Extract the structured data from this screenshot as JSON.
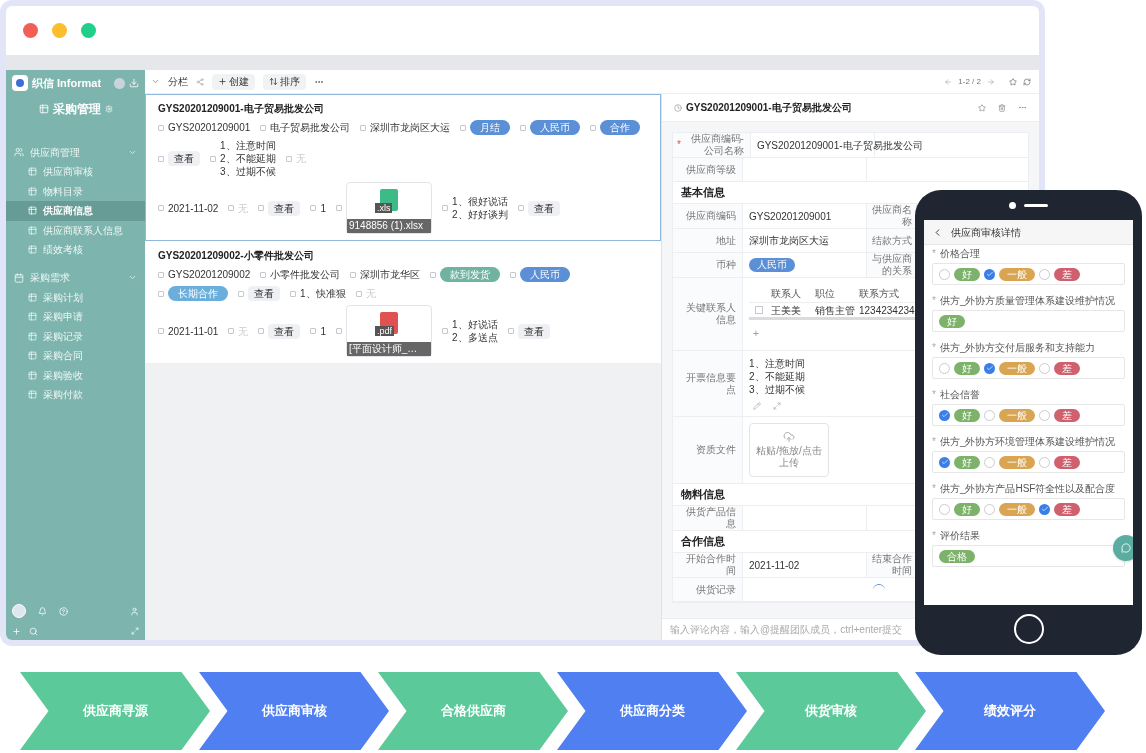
{
  "sidebar": {
    "app_name": "织信 Informat",
    "module": "采购管理",
    "groups": [
      {
        "label": "供应商管理",
        "expanded": true,
        "children": [
          {
            "label": "供应商审核",
            "selected": false
          },
          {
            "label": "物料目录",
            "selected": false
          },
          {
            "label": "供应商信息",
            "selected": true
          },
          {
            "label": "供应商联系人信息",
            "selected": false
          },
          {
            "label": "绩效考核",
            "selected": false
          }
        ]
      },
      {
        "label": "采购需求",
        "expanded": true,
        "children": [
          {
            "label": "采购计划",
            "selected": false
          },
          {
            "label": "采购申请",
            "selected": false
          },
          {
            "label": "采购记录",
            "selected": false
          },
          {
            "label": "采购合同",
            "selected": false
          },
          {
            "label": "采购验收",
            "selected": false
          },
          {
            "label": "采购付款",
            "selected": false
          }
        ]
      }
    ]
  },
  "toolbar": {
    "view": "分栏",
    "buttons": [
      "创建",
      "排序"
    ],
    "pagination": "1-2 / 2"
  },
  "records": [
    {
      "title": "GYS20201209001-电子贸易批发公司",
      "selected": true,
      "row1": [
        {
          "kind": "text",
          "text": "GYS20201209001"
        },
        {
          "kind": "text",
          "text": "电子贸易批发公司"
        },
        {
          "kind": "text",
          "text": "深圳市龙岗区大运"
        },
        {
          "kind": "tag",
          "text": "月结",
          "color": "#5b8fd6"
        },
        {
          "kind": "tag",
          "text": "人民币",
          "color": "#5b8fd6"
        },
        {
          "kind": "tag",
          "text": "合作",
          "color": "#5b8fd6"
        },
        {
          "kind": "button",
          "text": "查看"
        },
        {
          "kind": "lines",
          "lines": [
            "1、注意时间",
            "2、不能延期",
            "3、过期不候"
          ]
        },
        {
          "kind": "empty",
          "text": "无"
        }
      ],
      "row2": [
        {
          "kind": "text",
          "text": "2021-11-02"
        },
        {
          "kind": "empty",
          "text": "无"
        },
        {
          "kind": "button",
          "text": "查看"
        },
        {
          "kind": "text",
          "text": "1"
        },
        {
          "kind": "file",
          "ext": ".xls",
          "name": "9148856 (1).xlsx",
          "color": "#3dbb86"
        },
        {
          "kind": "lines",
          "lines": [
            "1、很好说话",
            "2、好好谈判"
          ]
        },
        {
          "kind": "button",
          "text": "查看"
        }
      ]
    },
    {
      "title": "GYS20201209002-小零件批发公司",
      "selected": false,
      "row1": [
        {
          "kind": "text",
          "text": "GYS20201209002"
        },
        {
          "kind": "text",
          "text": "小零件批发公司"
        },
        {
          "kind": "text",
          "text": "深圳市龙华区"
        },
        {
          "kind": "tag",
          "text": "款到发货",
          "color": "#6fb3a0"
        },
        {
          "kind": "tag",
          "text": "人民币",
          "color": "#5b8fd6"
        },
        {
          "kind": "tag",
          "text": "长期合作",
          "color": "#6aaedc"
        },
        {
          "kind": "button",
          "text": "查看"
        },
        {
          "kind": "lines",
          "lines": [
            "1、快准狠"
          ]
        },
        {
          "kind": "empty",
          "text": "无"
        }
      ],
      "row2": [
        {
          "kind": "text",
          "text": "2021-11-01"
        },
        {
          "kind": "empty",
          "text": "无"
        },
        {
          "kind": "button",
          "text": "查看"
        },
        {
          "kind": "text",
          "text": "1"
        },
        {
          "kind": "file",
          "ext": ".pdf",
          "name": "[平面设计师_…",
          "color": "#e05252"
        },
        {
          "kind": "lines",
          "lines": [
            "1、好说话",
            "2、多送点"
          ]
        },
        {
          "kind": "button",
          "text": "查看"
        }
      ]
    }
  ],
  "detail": {
    "title": "GYS20201209001-电子贸易批发公司",
    "rows": [
      {
        "kind": "field",
        "label": "供应商编码-公司名称",
        "required_mark": "*",
        "value": "GYS20201209001-电子贸易批发公司"
      },
      {
        "kind": "field",
        "label": "供应商等级"
      },
      {
        "kind": "section",
        "title": "基本信息"
      },
      {
        "kind": "field",
        "label": "供应商编码",
        "value": "GYS20201209001",
        "label2": "供应商名称"
      },
      {
        "kind": "field",
        "label": "地址",
        "value": "深圳市龙岗区大运",
        "label2": "结款方式"
      },
      {
        "kind": "field",
        "label": "币种",
        "tag": "人民币",
        "label2": "与供应商的关系"
      },
      {
        "kind": "table",
        "label": "关键联系人信息",
        "columns": [
          "联系人",
          "职位",
          "联系方式"
        ],
        "rows": [
          {
            "checked": false,
            "cells": [
              "王美美",
              "销售主管",
              "1234234234"
            ]
          }
        ],
        "add": "+"
      },
      {
        "kind": "lines",
        "label": "开票信息要点",
        "lines": [
          "1、注意时间",
          "2、不能延期",
          "3、过期不候"
        ]
      },
      {
        "kind": "upload",
        "label": "资质文件",
        "hint": "粘贴/拖放/点击上传"
      },
      {
        "kind": "section",
        "title": "物料信息"
      },
      {
        "kind": "field",
        "label": "供货产品信息"
      },
      {
        "kind": "section",
        "title": "合作信息"
      },
      {
        "kind": "field",
        "label": "开始合作时间",
        "value": "2021-11-02",
        "label2": "结束合作时间"
      },
      {
        "kind": "loading",
        "label": "供货记录"
      }
    ],
    "comment_placeholder": "输入评论内容，输入@提醒团队成员，ctrl+enter提交"
  },
  "phone": {
    "title": "供应商审核详情",
    "questions": [
      {
        "label": "价格合理",
        "required_mark": "*",
        "kind": "radio",
        "options": [
          {
            "text": "好",
            "color": "#7cb26a",
            "selected": false
          },
          {
            "text": "一般",
            "color": "#d9a553",
            "selected": true
          },
          {
            "text": "差",
            "color": "#d0606e",
            "selected": false
          }
        ]
      },
      {
        "label": "供方_外协方质量管理体系建设维护情况",
        "required_mark": "*",
        "kind": "value",
        "options": [
          {
            "text": "好",
            "color": "#7cb26a"
          }
        ]
      },
      {
        "label": "供方_外协方交付后服务和支持能力",
        "required_mark": "*",
        "kind": "radio",
        "options": [
          {
            "text": "好",
            "color": "#7cb26a",
            "selected": false
          },
          {
            "text": "一般",
            "color": "#d9a553",
            "selected": true
          },
          {
            "text": "差",
            "color": "#d0606e",
            "selected": false
          }
        ]
      },
      {
        "label": "社会信誉",
        "required_mark": "*",
        "kind": "radio",
        "options": [
          {
            "text": "好",
            "color": "#7cb26a",
            "selected": true
          },
          {
            "text": "一般",
            "color": "#d9a553",
            "selected": false
          },
          {
            "text": "差",
            "color": "#d0606e",
            "selected": false
          }
        ]
      },
      {
        "label": "供方_外协方环境管理体系建设维护情况",
        "required_mark": "*",
        "kind": "radio",
        "options": [
          {
            "text": "好",
            "color": "#7cb26a",
            "selected": true
          },
          {
            "text": "一般",
            "color": "#d9a553",
            "selected": false
          },
          {
            "text": "差",
            "color": "#d0606e",
            "selected": false
          }
        ]
      },
      {
        "label": "供方_外协方产品HSF符全性以及配合度",
        "required_mark": "*",
        "kind": "radio",
        "options": [
          {
            "text": "好",
            "color": "#7cb26a",
            "selected": false
          },
          {
            "text": "一般",
            "color": "#d9a553",
            "selected": false
          },
          {
            "text": "差",
            "color": "#d0606e",
            "selected": true
          }
        ]
      },
      {
        "label": "评价结果",
        "required_mark": "*",
        "kind": "value",
        "options": [
          {
            "text": "合格",
            "color": "#7cb26a"
          }
        ]
      }
    ]
  },
  "steps": [
    {
      "label": "供应商寻源",
      "color": "#5cc99a"
    },
    {
      "label": "供应商审核",
      "color": "#4f7ff0"
    },
    {
      "label": "合格供应商",
      "color": "#5cc99a"
    },
    {
      "label": "供应商分类",
      "color": "#4f7ff0"
    },
    {
      "label": "供货审核",
      "color": "#5cc99a"
    },
    {
      "label": "绩效评分",
      "color": "#4f7ff0"
    }
  ]
}
